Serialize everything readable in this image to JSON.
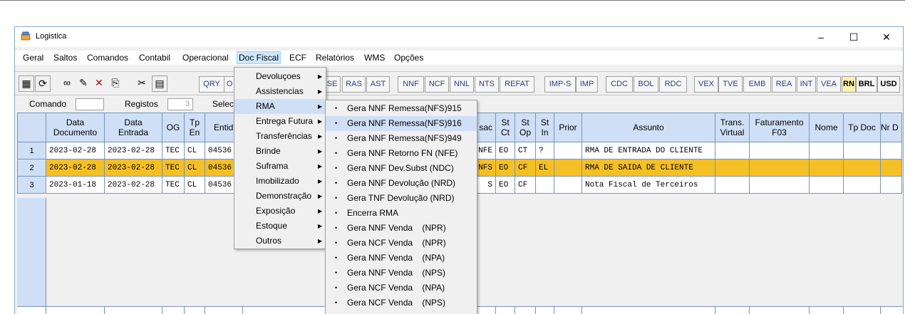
{
  "window": {
    "title": "Logistica",
    "minimize": "–",
    "maximize": "☐",
    "close": "✕"
  },
  "menu": [
    "Geral",
    "Saltos",
    "Comandos",
    "Contabil",
    "Operacional",
    "Doc Fiscal",
    "ECF",
    "Relatórios",
    "WMS",
    "Opções"
  ],
  "toolbar": {
    "buttons": [
      "QRY",
      "O",
      "SE",
      "RAS",
      "AST",
      "NNF",
      "NCF",
      "NNL",
      "NTS",
      "REFAT",
      "IMP-S",
      "IMP",
      "CDC",
      "BOL",
      "RDC",
      "VEX",
      "TVE",
      "EMB",
      "REA",
      "INT",
      "VEA",
      "RN",
      "BRL",
      "USD"
    ]
  },
  "cmd": {
    "comando_label": "Comando",
    "registos_label": "Registos",
    "registos_value": "3",
    "select_label": "Selec"
  },
  "grid": {
    "headers": [
      "",
      "Data\nDocumento",
      "Data\nEntrada",
      "OG",
      "Tp\nEn",
      "Entid",
      "sac",
      "St\nCt",
      "St\nOp",
      "St\nIn",
      "Prior",
      "Assunto",
      "Trans.\nVirtual",
      "Faturamento\nF03",
      "Nome",
      "Tp Doc",
      "Nr D"
    ],
    "rows": [
      {
        "n": "1",
        "data_doc": "2023-02-28",
        "data_ent": "2023-02-28",
        "og": "TEC",
        "tp": "CL",
        "entid": "04536",
        "sac": "NFE",
        "stct": "EO",
        "stop": "CT",
        "stin": "?",
        "prior": "",
        "assunto": "RMA DE ENTRADA DO CLIENTE"
      },
      {
        "n": "2",
        "data_doc": "2023-02-28",
        "data_ent": "2023-02-28",
        "og": "TEC",
        "tp": "CL",
        "entid": "04536",
        "sac": "NFS",
        "stct": "EO",
        "stop": "CF",
        "stin": "EL",
        "prior": "",
        "assunto": "RMA DE SAIDA DE CLIENTE"
      },
      {
        "n": "3",
        "data_doc": "2023-01-18",
        "data_ent": "2023-02-28",
        "og": "TEC",
        "tp": "CL",
        "entid": "04536",
        "sac": "S",
        "stct": "EO",
        "stop": "CF",
        "stin": "",
        "prior": "",
        "assunto": "Nota Fiscal de Terceiros"
      }
    ]
  },
  "docfiscal_menu": [
    "Devoluçoes",
    "Assistencias",
    "RMA",
    "Entrega Futura",
    "Transferências",
    "Brinde",
    "Suframa",
    "Imobilizado",
    "Demonstração",
    "Exposição",
    "Estoque",
    "Outros"
  ],
  "rma_menu": [
    "Gera NNF Remessa(NFS)915",
    "Gera NNF Remessa(NFS)916",
    "Gera NNF Remessa(NFS)949",
    "Gera NNF Retorno FN (NFE)",
    "Gera NNF Dev.Subst (NDC)",
    "Gera NNF Devolução (NRD)",
    "Gera TNF Devolução (NRD)",
    "Encerra RMA",
    "Gera NNF Venda    (NPR)",
    "Gera NCF Venda    (NPR)",
    "Gera NNF Venda    (NPA)",
    "Gera NNF Venda    (NPS)",
    "Gera NCF Venda    (NPA)",
    "Gera NCF Venda    (NPS)"
  ],
  "colors": {
    "header_bg": "#cfe0f6",
    "selected_row": "#f5c025",
    "menu_highlight": "#cfe0f6"
  }
}
